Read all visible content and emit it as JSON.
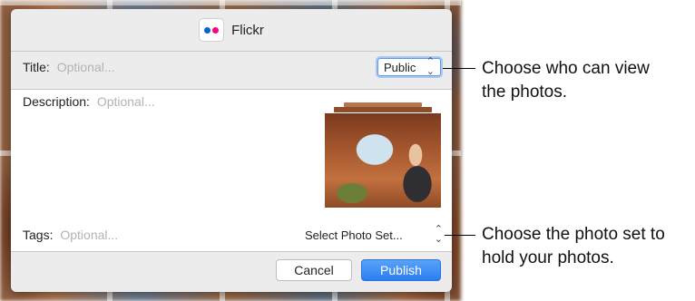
{
  "sheet": {
    "title": "Flickr",
    "title_field": {
      "label": "Title:",
      "placeholder": "Optional..."
    },
    "privacy_select": {
      "value": "Public"
    },
    "description_field": {
      "label": "Description:",
      "placeholder": "Optional..."
    },
    "tags_field": {
      "label": "Tags:",
      "placeholder": "Optional..."
    },
    "photo_set_select": {
      "value": "Select Photo Set..."
    },
    "buttons": {
      "cancel": "Cancel",
      "publish": "Publish"
    }
  },
  "callouts": {
    "privacy": [
      "Choose who can view",
      "the photos."
    ],
    "photo_set": [
      "Choose the photo set to",
      "hold your photos."
    ]
  },
  "colors": {
    "accent": "#2b7ef3",
    "flickr_blue": "#0063dc",
    "flickr_pink": "#ff0084"
  }
}
